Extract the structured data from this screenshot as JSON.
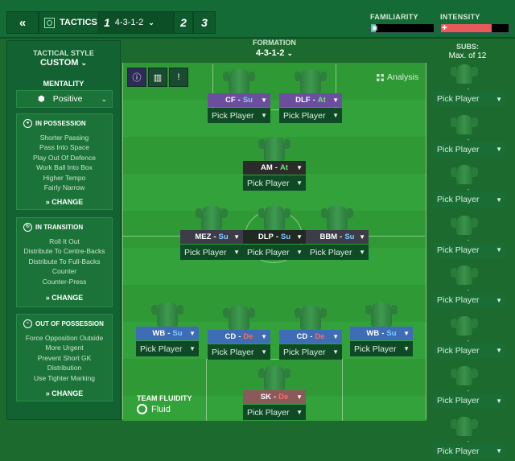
{
  "topbar": {
    "back_icon": "double-chevron-left-icon",
    "tactics_label": "TACTICS",
    "slot1_number": "1",
    "slot1_formation": "4-3-1-2",
    "slot2_number": "2",
    "slot3_number": "3",
    "familiarity_label": "FAMILIARITY",
    "intensity_label": "INTENSITY",
    "familiarity_value": 0.08,
    "intensity_value": 0.75
  },
  "sidebar": {
    "tactical_style_label": "TACTICAL STYLE",
    "tactical_style_value": "CUSTOM",
    "mentality_label": "MENTALITY",
    "mentality_value": "Positive",
    "change_label": "CHANGE",
    "in_possession": {
      "title": "IN POSSESSION",
      "items": [
        "Shorter Passing",
        "Pass Into Space",
        "Play Out Of Defence",
        "Work Ball Into Box",
        "Higher Tempo",
        "Fairly Narrow"
      ]
    },
    "in_transition": {
      "title": "IN TRANSITION",
      "items": [
        "Roll It Out",
        "Distribute To Centre-Backs",
        "Distribute To Full-Backs",
        "Counter",
        "Counter-Press"
      ]
    },
    "out_of_possession": {
      "title": "OUT OF POSSESSION",
      "items": [
        "Force Opposition Outside",
        "More Urgent",
        "Prevent Short GK",
        "Distribution",
        "Use Tighter Marking"
      ]
    }
  },
  "formation": {
    "label": "FORMATION",
    "value": "4-3-1-2"
  },
  "pitch": {
    "analysis_label": "Analysis",
    "pick_label": "Pick Player",
    "players": [
      {
        "pos": "CF",
        "role": "Su",
        "duty": "su",
        "tag_color": "#6b4f9e"
      },
      {
        "pos": "DLF",
        "role": "At",
        "duty": "at",
        "tag_color": "#6b4f9e"
      },
      {
        "pos": "AM",
        "role": "At",
        "duty": "at",
        "tag_color": "#2b2b2b"
      },
      {
        "pos": "MEZ",
        "role": "Su",
        "duty": "su",
        "tag_color": "#3d3d4a"
      },
      {
        "pos": "DLP",
        "role": "Su",
        "duty": "su",
        "tag_color": "#1f2a22"
      },
      {
        "pos": "BBM",
        "role": "Su",
        "duty": "su",
        "tag_color": "#3d3d4a"
      },
      {
        "pos": "WB",
        "role": "Su",
        "duty": "su",
        "tag_color": "#3e6cb5"
      },
      {
        "pos": "CD",
        "role": "De",
        "duty": "de",
        "tag_color": "#3e6cb5"
      },
      {
        "pos": "CD",
        "role": "De",
        "duty": "de",
        "tag_color": "#3e6cb5"
      },
      {
        "pos": "WB",
        "role": "Su",
        "duty": "su",
        "tag_color": "#3e6cb5"
      },
      {
        "pos": "SK",
        "role": "De",
        "duty": "de",
        "tag_color": "#8a5a5a"
      }
    ]
  },
  "team_fluidity": {
    "label": "TEAM FLUIDITY",
    "value": "Fluid"
  },
  "subs": {
    "title": "SUBS:",
    "subtitle": "Max. of 12",
    "pick_label": "Pick Player",
    "dash": "-"
  },
  "colors": {
    "familiarity_fill": "#3fc6a0",
    "intensity_fill": "#e85a5a"
  }
}
